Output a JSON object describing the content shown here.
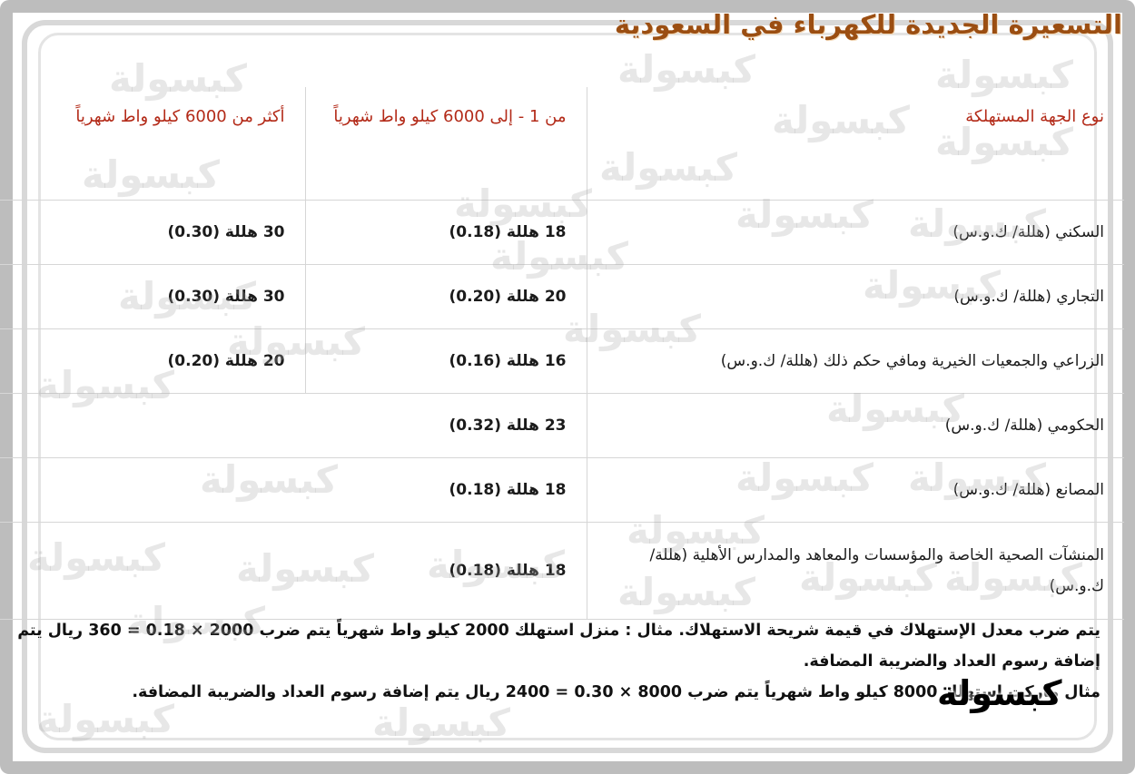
{
  "title": "التسعيرة الجديدة للكهرباء في السعودية",
  "table": {
    "headers": {
      "type": "نوع الجهة المستهلكة",
      "tier1": "من 1 - إلى 6000 كيلو واط شهرياً",
      "tier2": "أكثر من 6000 كيلو واط شهرياً"
    },
    "rows": [
      {
        "type": "السكني (هللة/ ك.و.س)",
        "tier1": "18 هللة (0.18)",
        "tier2": "30 هللة (0.30)"
      },
      {
        "type": "التجاري (هللة/ ك.و.س)",
        "tier1": "20 هللة (0.20)",
        "tier2": "30 هللة (0.30)"
      },
      {
        "type": "الزراعي والجمعيات الخيرية ومافي حكم ذلك (هللة/ ك.و.س)",
        "tier1": "16 هللة (0.16)",
        "tier2": "20 هللة (0.20)"
      },
      {
        "type": "الحكومي (هللة/ ك.و.س)",
        "flat": "23 هللة (0.32)"
      },
      {
        "type": "المصانع (هللة/ ك.و.س)",
        "flat": "18 هللة (0.18)"
      },
      {
        "type": "المنشآت الصحية الخاصة والمؤسسات والمعاهد والمدارس الأهلية (هللة/ ك.و.س)",
        "flat": "18 هللة (0.18)"
      }
    ]
  },
  "notes": {
    "line1": "يتم ضرب معدل الإستهلاك في قيمة شريحة الاستهلاك. مثال : منزل استهلك 2000 كيلو واط شهرياً يتم ضرب 2000 × 0.18 = 360 ريال يتم إضافة رسوم العداد والضريبة المضافة.",
    "line2": "مثال ماركت استهلك 8000 كيلو واط شهرياً يتم ضرب 8000 × 0.30 = 2400 ريال يتم إضافة رسوم العداد والضريبة المضافة."
  },
  "logo_text": "كبسولة",
  "watermark_text": "كبسولة",
  "colors": {
    "title": "#9b4e12",
    "header_text": "#b32a18",
    "border": "#d6d6d6"
  }
}
